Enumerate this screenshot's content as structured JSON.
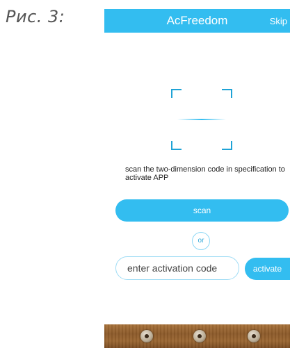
{
  "figure_label": "Рис. 3:",
  "header": {
    "title": "AcFreedom",
    "skip_label": "Skip"
  },
  "instructions": "scan the two-dimension code in specification to activate APP",
  "scan_button_label": "scan",
  "or_label": "or",
  "activation": {
    "placeholder": "enter activation code",
    "value": "",
    "button_label": "activate"
  },
  "colors": {
    "accent": "#33bdf0",
    "accent_light": "#9fdcf5",
    "nav_wood": "#8c5a2a"
  },
  "nav_icons": [
    "back-icon",
    "home-icon",
    "menu-icon"
  ]
}
